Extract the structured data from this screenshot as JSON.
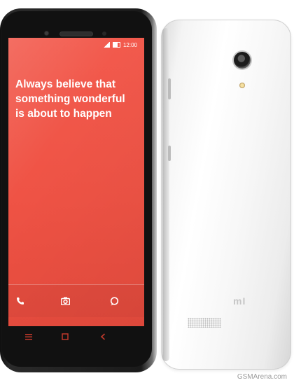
{
  "screen": {
    "status_time": "12:00",
    "headline_lines": [
      "Always believe that",
      "something wonderful",
      "is about to happen"
    ],
    "dock_icons": [
      "phone-icon",
      "camera-icon",
      "chat-icon"
    ],
    "nav_icons": [
      "menu-icon",
      "home-icon",
      "back-icon"
    ],
    "wallpaper_color": "#ef5345",
    "text_color": "#ffffff"
  },
  "back": {
    "logo": "mI",
    "body_color": "#f4f4f4"
  },
  "watermark": "GSMArena.com"
}
